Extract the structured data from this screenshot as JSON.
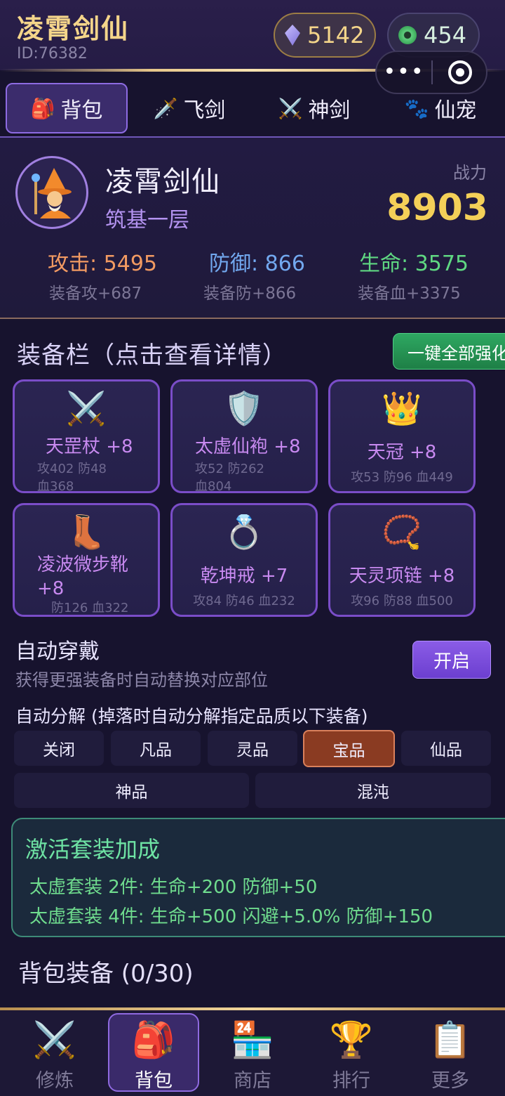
{
  "header": {
    "title": "凌霄剑仙",
    "user_id": "ID:76382",
    "spirit_stones": "5142",
    "jade": "454"
  },
  "tabs": [
    {
      "label": "背包",
      "icon": "backpack-icon",
      "glyph": "🎒"
    },
    {
      "label": "飞剑",
      "icon": "dagger-icon",
      "glyph": "🗡️"
    },
    {
      "label": "神剑",
      "icon": "crossed-swords-icon",
      "glyph": "⚔️"
    },
    {
      "label": "仙宠",
      "icon": "paw-icon",
      "glyph": "🐾"
    }
  ],
  "profile": {
    "name": "凌霄剑仙",
    "realm": "筑基一层",
    "power_label": "战力",
    "power": "8903",
    "attack": "攻击: 5495",
    "defense": "防御: 866",
    "health": "生命: 3575",
    "equip_attack": "装备攻+687",
    "equip_defense": "装备防+866",
    "equip_health": "装备血+3375"
  },
  "equipment": {
    "title": "装备栏（点击查看详情）",
    "strengthen_all": "一键全部强化",
    "items": [
      {
        "icon": "crossed-swords-icon",
        "glyph": "⚔️",
        "name": "天罡杖 +8",
        "stats": "攻402 防48 血368"
      },
      {
        "icon": "shield-icon",
        "glyph": "🛡️",
        "name": "太虚仙袍 +8",
        "stats": "攻52 防262 血804"
      },
      {
        "icon": "crown-icon",
        "glyph": "👑",
        "name": "天冠 +8",
        "stats": "攻53 防96 血449"
      },
      {
        "icon": "boot-icon",
        "glyph": "👢",
        "name": "凌波微步靴 +8",
        "stats": "防126 血322"
      },
      {
        "icon": "ring-icon",
        "glyph": "💍",
        "name": "乾坤戒 +7",
        "stats": "攻84 防46 血232"
      },
      {
        "icon": "prayer-beads-icon",
        "glyph": "📿",
        "name": "天灵项链 +8",
        "stats": "攻96 防88 血500"
      }
    ]
  },
  "auto_wear": {
    "title": "自动穿戴",
    "desc": "获得更强装备时自动替换对应部位",
    "button": "开启"
  },
  "auto_decompose": {
    "title": "自动分解 (掉落时自动分解指定品质以下装备)",
    "options": [
      "关闭",
      "凡品",
      "灵品",
      "宝品",
      "仙品",
      "神品",
      "混沌"
    ],
    "selected": "宝品"
  },
  "set_bonus": {
    "title": "激活套装加成",
    "lines": [
      "太虚套装 2件: 生命+200 防御+50",
      "太虚套装 4件: 生命+500 闪避+5.0% 防御+150"
    ]
  },
  "bag": {
    "title": "背包装备 (0/30)"
  },
  "nav": [
    {
      "label": "修炼",
      "icon": "crossed-swords-icon",
      "glyph": "⚔️"
    },
    {
      "label": "背包",
      "icon": "backpack-icon",
      "glyph": "🎒"
    },
    {
      "label": "商店",
      "icon": "store-icon",
      "glyph": "🏪"
    },
    {
      "label": "排行",
      "icon": "trophy-icon",
      "glyph": "🏆"
    },
    {
      "label": "更多",
      "icon": "clipboard-icon",
      "glyph": "📋"
    }
  ],
  "colors": {
    "gold": "#f4d58a",
    "purple_accent": "#8d6be2",
    "attack": "#f29a62",
    "defense": "#72a8ef",
    "health": "#5fd882",
    "selected_quality": "#8a3b22"
  }
}
